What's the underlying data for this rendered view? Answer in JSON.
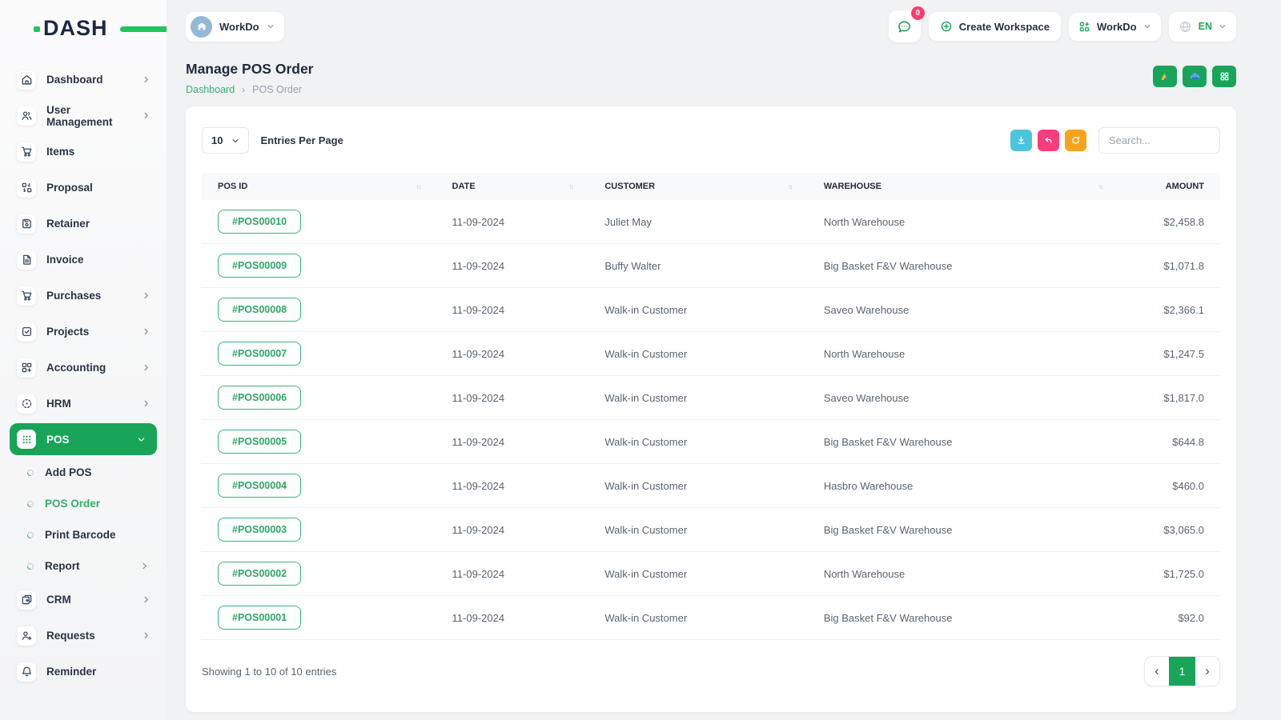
{
  "brand": {
    "logo_text": "DASH"
  },
  "topbar": {
    "workspace_name": "WorkDo",
    "messages_badge": "0",
    "create_workspace_label": "Create Workspace",
    "workdo_dropdown_label": "WorkDo",
    "language_code": "EN"
  },
  "page": {
    "title": "Manage POS Order",
    "breadcrumb_home": "Dashboard",
    "breadcrumb_current": "POS Order"
  },
  "sidebar": {
    "items": [
      {
        "label": "Dashboard",
        "icon": "home-icon"
      },
      {
        "label": "User Management",
        "icon": "users-icon"
      },
      {
        "label": "Items",
        "icon": "cart-icon"
      },
      {
        "label": "Proposal",
        "icon": "swap-grid-icon"
      },
      {
        "label": "Retainer",
        "icon": "floppy-icon"
      },
      {
        "label": "Invoice",
        "icon": "document-icon"
      },
      {
        "label": "Purchases",
        "icon": "cart-icon"
      },
      {
        "label": "Projects",
        "icon": "check-square-icon"
      },
      {
        "label": "Accounting",
        "icon": "grid-plus-icon"
      },
      {
        "label": "HRM",
        "icon": "target-icon"
      },
      {
        "label": "POS",
        "icon": "dots-grid-icon"
      },
      {
        "label": "CRM",
        "icon": "cards-icon"
      },
      {
        "label": "Requests",
        "icon": "user-plus-icon"
      },
      {
        "label": "Reminder",
        "icon": "bell-icon"
      }
    ],
    "pos_subitems": [
      {
        "label": "Add POS"
      },
      {
        "label": "POS Order",
        "active": true
      },
      {
        "label": "Print Barcode"
      },
      {
        "label": "Report"
      }
    ]
  },
  "toolbar": {
    "entries_per_page_value": "10",
    "entries_per_page_label": "Entries Per Page",
    "search_placeholder": "Search..."
  },
  "table": {
    "columns": [
      "POS ID",
      "DATE",
      "CUSTOMER",
      "WAREHOUSE",
      "AMOUNT"
    ],
    "rows": [
      {
        "pos_id": "#POS00010",
        "date": "11-09-2024",
        "customer": "Juliet May",
        "warehouse": "North Warehouse",
        "amount": "$2,458.8"
      },
      {
        "pos_id": "#POS00009",
        "date": "11-09-2024",
        "customer": "Buffy Walter",
        "warehouse": "Big Basket F&V Warehouse",
        "amount": "$1,071.8"
      },
      {
        "pos_id": "#POS00008",
        "date": "11-09-2024",
        "customer": "Walk-in Customer",
        "warehouse": "Saveo Warehouse",
        "amount": "$2,366.1"
      },
      {
        "pos_id": "#POS00007",
        "date": "11-09-2024",
        "customer": "Walk-in Customer",
        "warehouse": "North Warehouse",
        "amount": "$1,247.5"
      },
      {
        "pos_id": "#POS00006",
        "date": "11-09-2024",
        "customer": "Walk-in Customer",
        "warehouse": "Saveo Warehouse",
        "amount": "$1,817.0"
      },
      {
        "pos_id": "#POS00005",
        "date": "11-09-2024",
        "customer": "Walk-in Customer",
        "warehouse": "Big Basket F&V Warehouse",
        "amount": "$644.8"
      },
      {
        "pos_id": "#POS00004",
        "date": "11-09-2024",
        "customer": "Walk-in Customer",
        "warehouse": "Hasbro Warehouse",
        "amount": "$460.0"
      },
      {
        "pos_id": "#POS00003",
        "date": "11-09-2024",
        "customer": "Walk-in Customer",
        "warehouse": "Big Basket F&V Warehouse",
        "amount": "$3,065.0"
      },
      {
        "pos_id": "#POS00002",
        "date": "11-09-2024",
        "customer": "Walk-in Customer",
        "warehouse": "North Warehouse",
        "amount": "$1,725.0"
      },
      {
        "pos_id": "#POS00001",
        "date": "11-09-2024",
        "customer": "Walk-in Customer",
        "warehouse": "Big Basket F&V Warehouse",
        "amount": "$92.0"
      }
    ]
  },
  "footer": {
    "showing_text": "Showing 1 to 10 of 10 entries",
    "current_page": "1"
  },
  "colors": {
    "accent_green": "#18a55a",
    "link_green": "#35b374",
    "badge_pink": "#fd3c72",
    "btn_teal": "#4bc5dd",
    "btn_pink": "#fb3c7f",
    "btn_orange": "#f9a21b"
  }
}
